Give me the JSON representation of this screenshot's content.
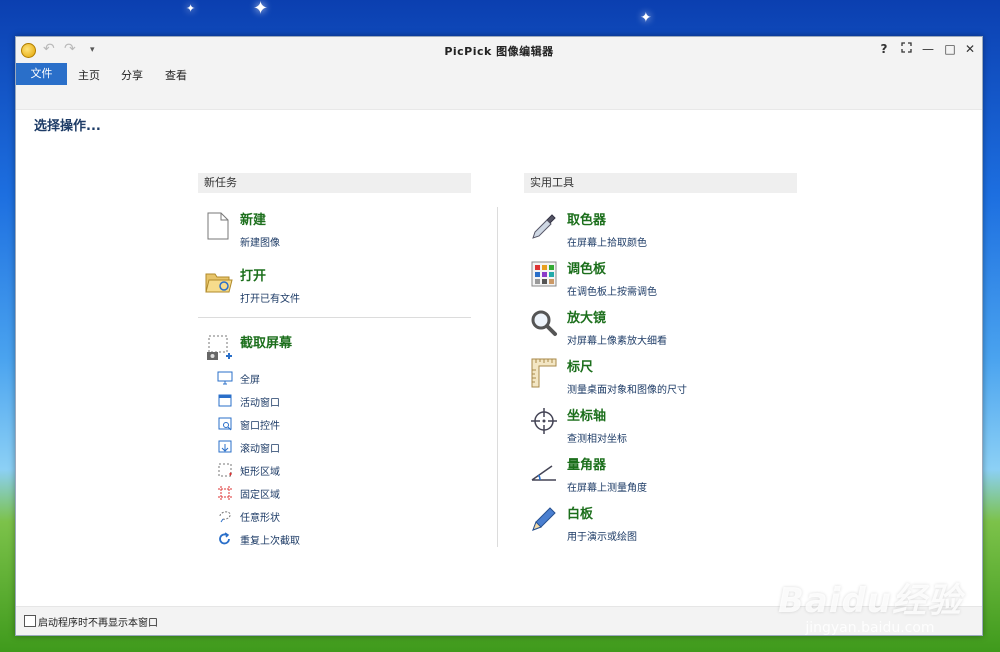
{
  "window": {
    "title": "PicPick 图像编辑器",
    "help": "?",
    "min": "—",
    "max": "□",
    "close": "✕"
  },
  "menu": {
    "file": "文件",
    "home": "主页",
    "share": "分享",
    "view": "查看"
  },
  "heading": "选择操作...",
  "new_task": {
    "header": "新任务",
    "items": [
      {
        "title": "新建",
        "sub": "新建图像",
        "icon": "new-file-icon"
      },
      {
        "title": "打开",
        "sub": "打开已有文件",
        "icon": "open-folder-icon"
      },
      {
        "title": "截取屏幕",
        "icon": "screen-capture-icon"
      }
    ],
    "capture_options": [
      {
        "label": "全屏",
        "icon": "monitor-icon"
      },
      {
        "label": "活动窗口",
        "icon": "window-icon"
      },
      {
        "label": "窗口控件",
        "icon": "window-control-icon"
      },
      {
        "label": "滚动窗口",
        "icon": "scroll-window-icon"
      },
      {
        "label": "矩形区域",
        "icon": "rectangle-region-icon"
      },
      {
        "label": "固定区域",
        "icon": "fixed-region-icon"
      },
      {
        "label": "任意形状",
        "icon": "freehand-icon"
      },
      {
        "label": "重复上次截取",
        "icon": "repeat-icon"
      }
    ]
  },
  "tools": {
    "header": "实用工具",
    "items": [
      {
        "title": "取色器",
        "sub": "在屏幕上拾取颜色",
        "icon": "eyedropper-icon"
      },
      {
        "title": "调色板",
        "sub": "在调色板上按需调色",
        "icon": "palette-icon"
      },
      {
        "title": "放大镜",
        "sub": "对屏幕上像素放大细看",
        "icon": "magnifier-icon"
      },
      {
        "title": "标尺",
        "sub": "测量桌面对象和图像的尺寸",
        "icon": "ruler-icon"
      },
      {
        "title": "坐标轴",
        "sub": "查测相对坐标",
        "icon": "crosshair-icon"
      },
      {
        "title": "量角器",
        "sub": "在屏幕上测量角度",
        "icon": "protractor-icon"
      },
      {
        "title": "白板",
        "sub": "用于演示或绘图",
        "icon": "pen-icon"
      }
    ]
  },
  "footer": {
    "checkbox_label": "启动程序时不再显示本窗口"
  },
  "watermark": {
    "brand": "Baidu",
    "brand_cn": "经验",
    "url": "jingyan.baidu.com"
  },
  "colors": {
    "accent": "#2a6fc9",
    "title_green": "#1c6f1c",
    "sub_navy": "#1d3b66"
  }
}
